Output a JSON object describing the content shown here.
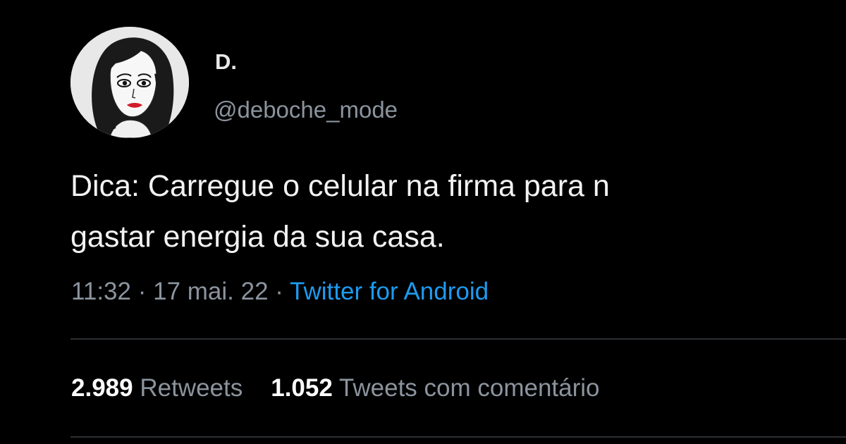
{
  "author": {
    "display_name": "D.",
    "handle": "@deboche_mode"
  },
  "tweet": {
    "text_line1": "Dica: Carregue o celular na firma para n",
    "text_line2": "gastar energia da sua casa."
  },
  "meta": {
    "time": "11:32",
    "separator": " · ",
    "date": "17 mai. 22",
    "source": "Twitter for Android"
  },
  "stats": {
    "retweets_count": "2.989",
    "retweets_label": "Retweets",
    "quotes_count": "1.052",
    "quotes_label": "Tweets com comentário"
  },
  "colors": {
    "background": "#000000",
    "muted_text": "#8b949e",
    "link": "#1d9bf0",
    "divider": "#2b2f33"
  }
}
